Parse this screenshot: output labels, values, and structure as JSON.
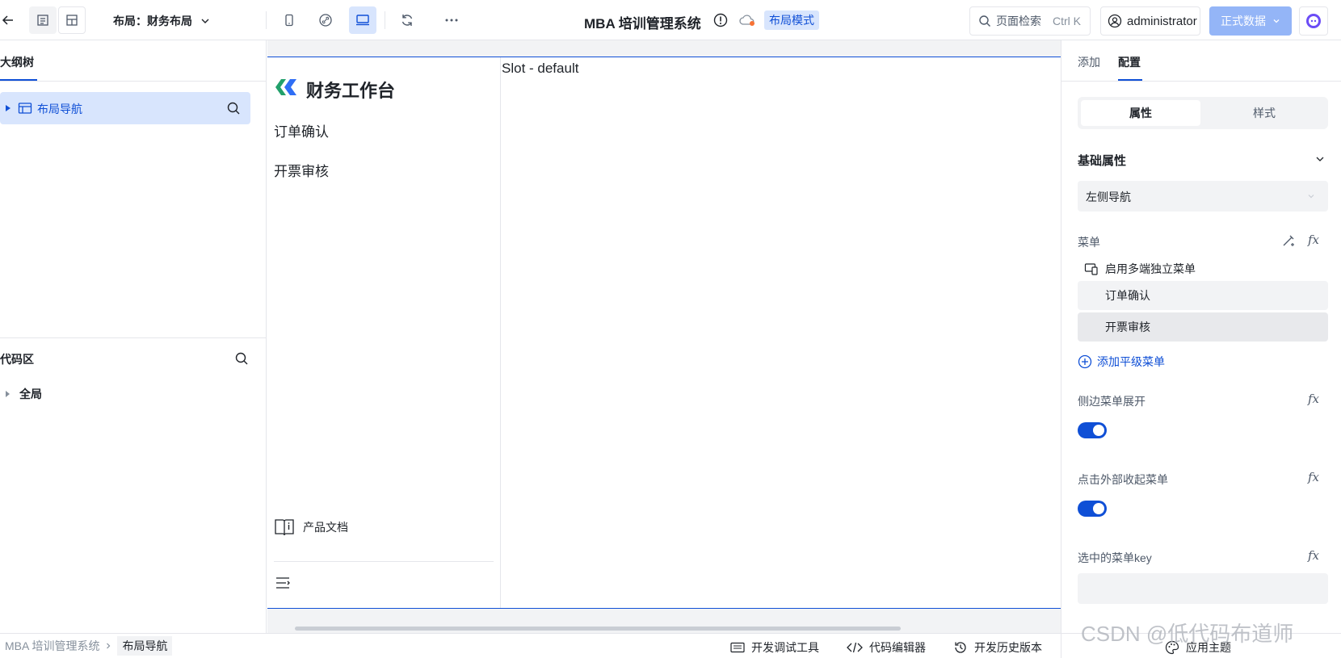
{
  "topbar": {
    "layout_label": "布局：财务布局",
    "app_title": "MBA 培训管理系统",
    "mode_badge": "布局模式",
    "search_placeholder": "页面检索",
    "search_shortcut": "Ctrl K",
    "user": "administrator",
    "data_button": "正式数据"
  },
  "left": {
    "outline_tab": "大纲树",
    "tree_item": "布局导航",
    "code_title": "代码区",
    "code_item": "全局"
  },
  "canvas": {
    "brand": "财务工作台",
    "nav_items": [
      "订单确认",
      "开票审核"
    ],
    "slot_text": "Slot - default",
    "docs_label": "产品文档"
  },
  "right": {
    "tabs": [
      "添加",
      "配置"
    ],
    "segments": [
      "属性",
      "样式"
    ],
    "section_title": "基础属性",
    "nav_select": "左侧导航",
    "menu_label": "菜单",
    "multi_menu": "启用多端独立菜单",
    "menu_items": [
      "订单确认",
      "开票审核"
    ],
    "add_menu": "添加平级菜单",
    "expand_label": "侧边菜单展开",
    "collapse_label": "点击外部收起菜单",
    "selected_key_label": "选中的菜单key",
    "fx": "fx"
  },
  "status": {
    "breadcrumb": [
      "MBA 培训管理系统",
      "布局导航"
    ],
    "tools": [
      "开发调试工具",
      "代码编辑器",
      "开发历史版本"
    ],
    "theme": "应用主题",
    "watermark": "CSDN @低代码布道师"
  },
  "colors": {
    "accent": "#0f4fd6",
    "active_bg": "#d8e5fd",
    "data_button_bg": "#94b5f7"
  }
}
